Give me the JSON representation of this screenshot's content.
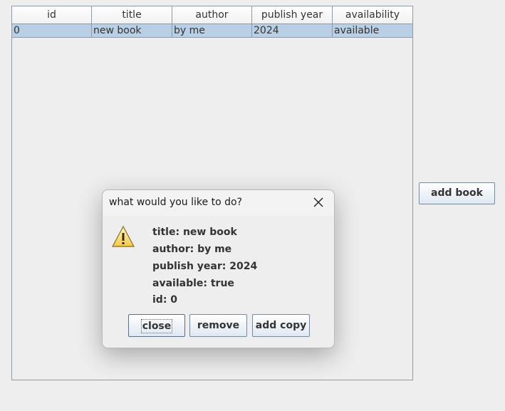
{
  "table": {
    "columns": [
      "id",
      "title",
      "author",
      "publish year",
      "availability"
    ],
    "rows": [
      {
        "id": "0",
        "title": "new book",
        "author": "by me",
        "publish_year": "2024",
        "availability": "available"
      }
    ],
    "selected_row_color": "#b8cfe5"
  },
  "buttons": {
    "add_book": "add book"
  },
  "dialog": {
    "title": "what would you like to do?",
    "icon": "warning-icon",
    "lines": [
      "title: new book",
      "author: by me",
      "publish year: 2024",
      "available: true",
      "id: 0"
    ],
    "buttons": {
      "close": "close",
      "remove": "remove",
      "add_copy": "add copy"
    }
  }
}
